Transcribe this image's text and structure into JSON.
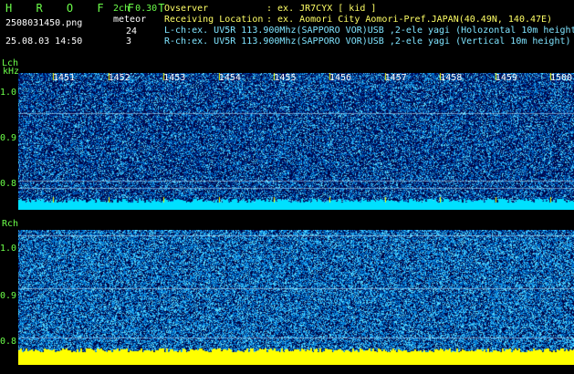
{
  "app": {
    "brand": "H R O F F T"
  },
  "file": {
    "name": "2508031450.png",
    "datetime": "25.08.03 14:50"
  },
  "mode": {
    "channels": "2ch 0.30",
    "type": "meteor",
    "count_l": "24",
    "count_r": "3"
  },
  "info": {
    "observer_label": "Ovserver",
    "observer_value": ": ex. JR7CYX [ kid ]",
    "location_label": "Receiving Location",
    "location_value": ": ex. Aomori City Aomori-Pref.JAPAN(40.49N, 140.47E)",
    "lch": "L-ch:ex. UV5R 113.900Mhz(SAPPORO VOR)USB ,2-ele yagi (Holozontal 10m height",
    "rch": "R-ch:ex. UV5R 113.900Mhz(SAPPORO VOR)USB ,2-ele yagi (Vertical 10m height)"
  },
  "axis": {
    "lch_label": "Lch",
    "rch_label": "Rch",
    "unit": "kHz",
    "freq_ticks": [
      "1.0",
      "0.9",
      "0.8"
    ],
    "time_ticks": [
      "1451",
      "1452",
      "1453",
      "1454",
      "1455",
      "1456",
      "1457",
      "1458",
      "1459",
      "1500"
    ]
  },
  "colors": {
    "label": "#6cff4a",
    "noise_dark": "#000a5a",
    "noise_light": "#4fd0ff",
    "baseline_l": "#00e0ff",
    "baseline_r": "#ffff00"
  }
}
